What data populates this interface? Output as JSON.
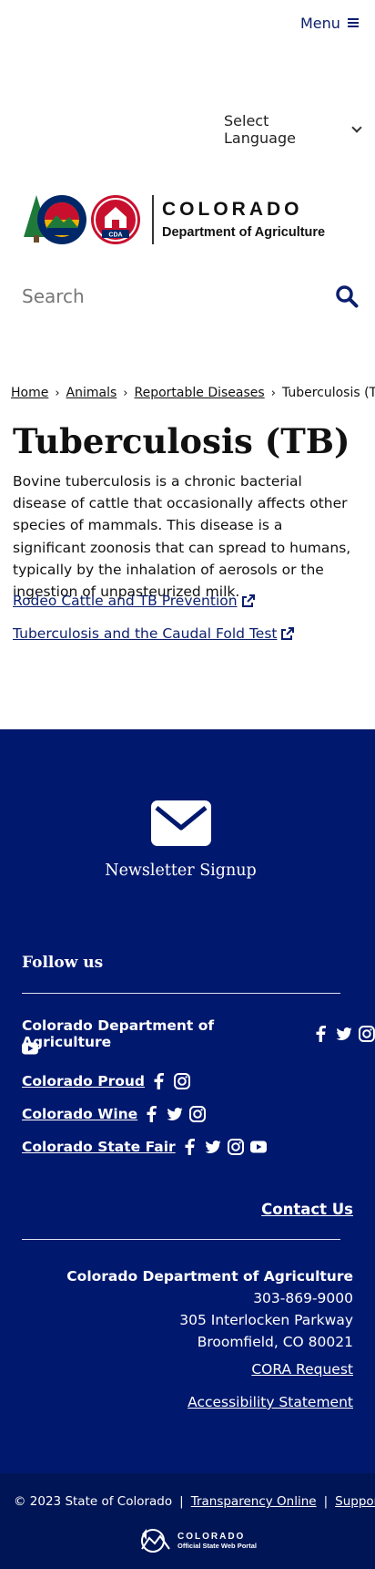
{
  "header": {
    "menu_label": "Menu",
    "language_label": "Select Language",
    "logo": {
      "line1": "COLORADO",
      "line2": "Department of Agriculture",
      "badge": "CDA"
    },
    "search_placeholder": "Search"
  },
  "breadcrumb": {
    "items": [
      "Home",
      "Animals",
      "Reportable Diseases"
    ],
    "current": "Tuberculosis (TB)"
  },
  "main": {
    "title": "Tuberculosis (TB)",
    "intro": "Bovine tuberculosis is a chronic bacterial disease of cattle that occasionally affects other species of mammals. This disease is a significant zoonosis that can spread to humans, typically by the inhalation of aerosols or the ingestion of unpasteurized milk.",
    "links": [
      "Rodeo Cattle and TB Prevention",
      "Tuberculosis and the Caudal Fold Test"
    ]
  },
  "footer": {
    "newsletter_label": "Newsletter Signup",
    "follow_label": "Follow us",
    "social": [
      {
        "name": "Colorado Department of Agriculture",
        "icons": [
          "facebook-icon",
          "twitter-icon",
          "instagram-icon",
          "youtube-icon"
        ]
      },
      {
        "name": "Colorado Proud",
        "icons": [
          "facebook-icon",
          "instagram-icon"
        ]
      },
      {
        "name": "Colorado Wine",
        "icons": [
          "facebook-icon",
          "twitter-icon",
          "instagram-icon"
        ]
      },
      {
        "name": "Colorado State Fair",
        "icons": [
          "facebook-icon",
          "twitter-icon",
          "instagram-icon",
          "youtube-icon"
        ]
      }
    ],
    "contact_label": "Contact Us",
    "address": {
      "org": "Colorado Department of Agriculture",
      "phone": "303-869-9000",
      "street": "305 Interlocken Parkway",
      "city": "Broomfield, CO 80021"
    },
    "cora_label": "CORA Request",
    "accessibility_label": "Accessibility Statement",
    "copyright": "© 2023 State of Colorado",
    "pipe": "|",
    "transparency_label": "Transparency Online",
    "support_label": "Support",
    "portal": {
      "line1": "COLORADO",
      "line2": "Official State Web Portal"
    }
  },
  "colors": {
    "navy": "#00186e",
    "navy_dark": "#001555",
    "link": "#0b1f6e",
    "red": "#c8102e",
    "gold": "#f2b300"
  }
}
